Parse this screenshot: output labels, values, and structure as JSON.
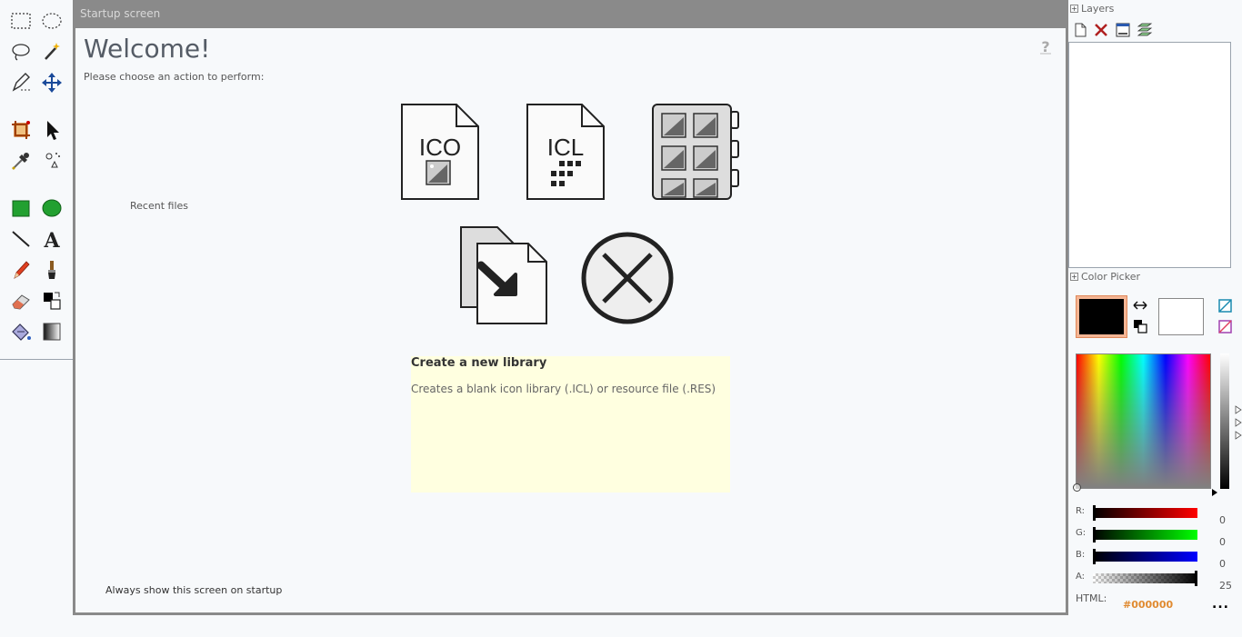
{
  "dialog": {
    "title": "Startup screen",
    "welcome": "Welcome!",
    "subtitle": "Please choose an action to perform:",
    "recent_files_label": "Recent files",
    "actions": {
      "ico_label": "ICO",
      "icl_label": "ICL"
    },
    "info": {
      "title": "Create a new library",
      "description": "Creates a blank icon library (.ICL) or resource file (.RES)"
    },
    "always_show_label": "Always show this screen on startup"
  },
  "layers": {
    "header": "Layers"
  },
  "color_picker": {
    "header": "Color Picker",
    "primary_color": "#000000",
    "secondary_color": "#ffffff",
    "channels": [
      {
        "label": "R:",
        "value": "0"
      },
      {
        "label": "G:",
        "value": "0"
      },
      {
        "label": "B:",
        "value": "0"
      },
      {
        "label": "A:",
        "value": "25"
      }
    ],
    "html_label": "HTML:",
    "html_value": "#000000",
    "more_label": "..."
  }
}
